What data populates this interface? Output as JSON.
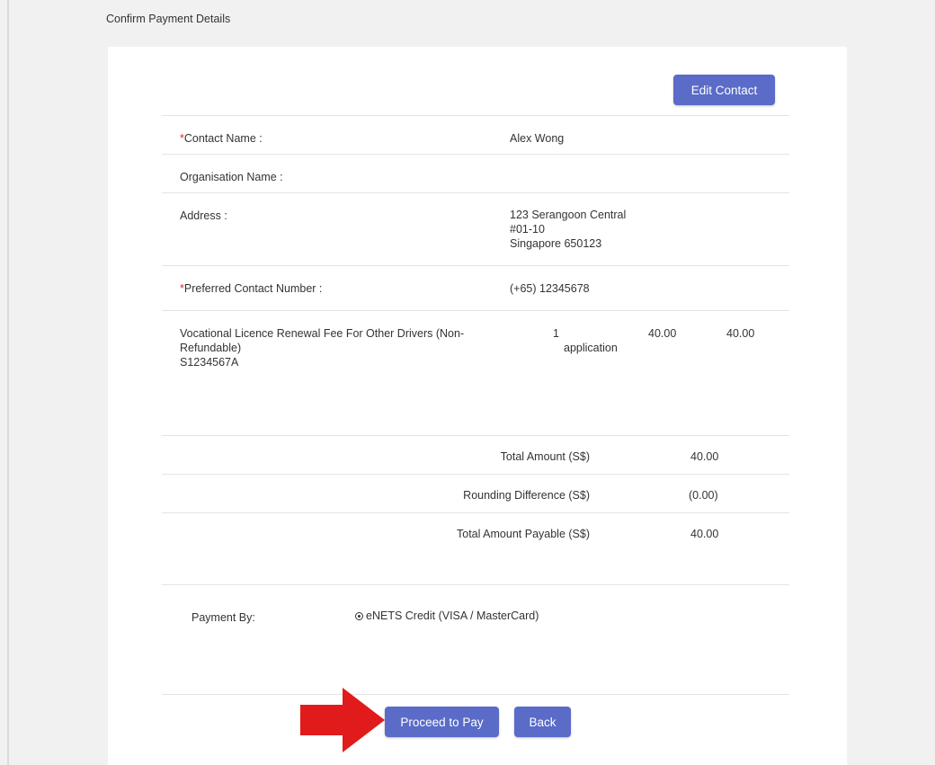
{
  "page": {
    "title": "Confirm Payment Details"
  },
  "buttons": {
    "edit_contact": "Edit Contact",
    "proceed": "Proceed to Pay",
    "back": "Back"
  },
  "contact": {
    "name_label": "Contact Name :",
    "name_value": "Alex Wong",
    "org_label": "Organisation Name :",
    "org_value": "",
    "address_label": "Address :",
    "address_lines": [
      "123 Serangoon Central",
      "#01-10",
      "Singapore 650123"
    ],
    "phone_label": "Preferred Contact Number :",
    "phone_value": "(+65) 12345678",
    "required_mark": "*"
  },
  "item": {
    "description_lines": [
      "Vocational Licence Renewal Fee For Other Drivers (Non-",
      "Refundable)",
      "S1234567A"
    ],
    "qty_lines": [
      "1",
      "application"
    ],
    "unit_price": "40.00",
    "amount": "40.00"
  },
  "totals": [
    {
      "label": "Total Amount (S$)",
      "value": "40.00"
    },
    {
      "label": "Rounding Difference (S$)",
      "value": "(0.00)"
    },
    {
      "label": "Total Amount Payable (S$)",
      "value": "40.00"
    }
  ],
  "payment": {
    "label": "Payment By:",
    "option": "eNETS Credit (VISA / MasterCard)",
    "selected": true
  },
  "colors": {
    "button": "#5a6bc8",
    "arrow": "#e11b1b",
    "required": "#d62b2b"
  }
}
